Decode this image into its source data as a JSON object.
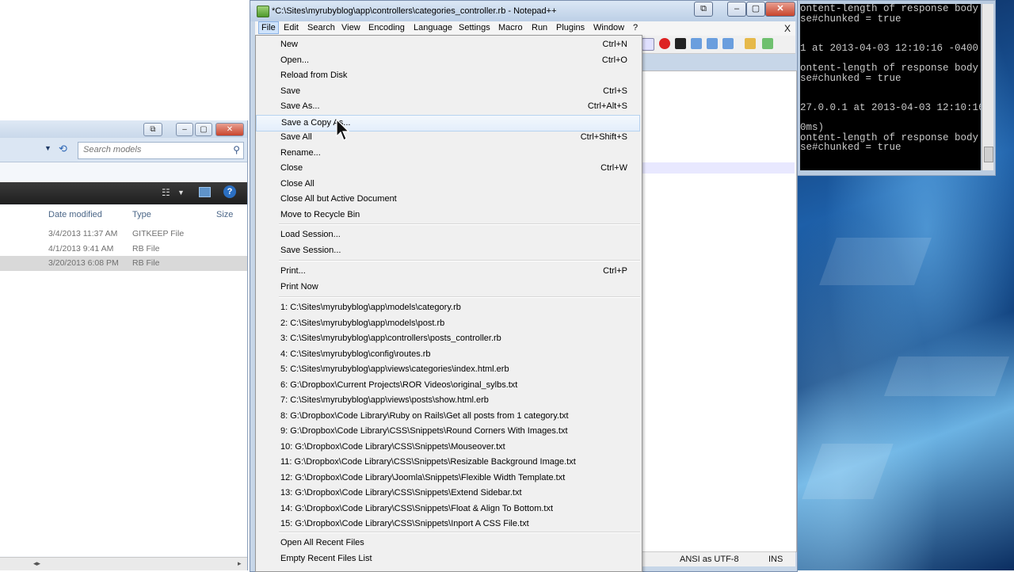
{
  "console": {
    "lines": [
      "ontent-length of response body.",
      "se#chunked = true",
      "",
      "",
      "1 at 2013-04-03 12:10:16 -0400",
      "",
      "ontent-length of response body.",
      "se#chunked = true",
      "",
      "",
      "27.0.0.1 at 2013-04-03 12:10:16",
      "",
      "0ms)",
      "ontent-length of response body.",
      "se#chunked = true"
    ]
  },
  "explorer": {
    "search_placeholder": "Search models",
    "columns": [
      "Date modified",
      "Type",
      "Size"
    ],
    "rows": [
      {
        "date": "3/4/2013 11:37 AM",
        "type": "GITKEEP File"
      },
      {
        "date": "4/1/2013 9:41 AM",
        "type": "RB File"
      },
      {
        "date": "3/20/2013 6:08 PM",
        "type": "RB File"
      }
    ]
  },
  "notepad": {
    "title": "*C:\\Sites\\myrubyblog\\app\\controllers\\categories_controller.rb - Notepad++",
    "menus": [
      "File",
      "Edit",
      "Search",
      "View",
      "Encoding",
      "Language",
      "Settings",
      "Macro",
      "Run",
      "Plugins",
      "Window",
      "?"
    ],
    "close_doc": "X",
    "status": {
      "encoding": "ANSI as UTF-8",
      "mode": "INS"
    }
  },
  "file_menu": {
    "items": [
      {
        "label": "New",
        "shortcut": "Ctrl+N"
      },
      {
        "label": "Open...",
        "shortcut": "Ctrl+O"
      },
      {
        "label": "Reload from Disk",
        "shortcut": ""
      },
      {
        "label": "Save",
        "shortcut": "Ctrl+S"
      },
      {
        "label": "Save As...",
        "shortcut": "Ctrl+Alt+S"
      },
      {
        "label": "Save a Copy As...",
        "shortcut": ""
      },
      {
        "label": "Save All",
        "shortcut": "Ctrl+Shift+S"
      },
      {
        "label": "Rename...",
        "shortcut": ""
      },
      {
        "label": "Close",
        "shortcut": "Ctrl+W"
      },
      {
        "label": "Close All",
        "shortcut": ""
      },
      {
        "label": "Close All but Active Document",
        "shortcut": ""
      },
      {
        "label": "Move to Recycle Bin",
        "shortcut": ""
      },
      {
        "label": "Load Session...",
        "shortcut": ""
      },
      {
        "label": "Save Session...",
        "shortcut": ""
      },
      {
        "label": "Print...",
        "shortcut": "Ctrl+P"
      },
      {
        "label": "Print Now",
        "shortcut": ""
      },
      {
        "label": "1: C:\\Sites\\myrubyblog\\app\\models\\category.rb",
        "shortcut": ""
      },
      {
        "label": "2: C:\\Sites\\myrubyblog\\app\\models\\post.rb",
        "shortcut": ""
      },
      {
        "label": "3: C:\\Sites\\myrubyblog\\app\\controllers\\posts_controller.rb",
        "shortcut": ""
      },
      {
        "label": "4: C:\\Sites\\myrubyblog\\config\\routes.rb",
        "shortcut": ""
      },
      {
        "label": "5: C:\\Sites\\myrubyblog\\app\\views\\categories\\index.html.erb",
        "shortcut": ""
      },
      {
        "label": "6: G:\\Dropbox\\Current Projects\\ROR Videos\\original_sylbs.txt",
        "shortcut": ""
      },
      {
        "label": "7: C:\\Sites\\myrubyblog\\app\\views\\posts\\show.html.erb",
        "shortcut": ""
      },
      {
        "label": "8: G:\\Dropbox\\Code Library\\Ruby on Rails\\Get all posts from 1 category.txt",
        "shortcut": ""
      },
      {
        "label": "9: G:\\Dropbox\\Code Library\\CSS\\Snippets\\Round Corners With Images.txt",
        "shortcut": ""
      },
      {
        "label": "10: G:\\Dropbox\\Code Library\\CSS\\Snippets\\Mouseover.txt",
        "shortcut": ""
      },
      {
        "label": "11: G:\\Dropbox\\Code Library\\CSS\\Snippets\\Resizable Background Image.txt",
        "shortcut": ""
      },
      {
        "label": "12: G:\\Dropbox\\Code Library\\Joomla\\Snippets\\Flexible Width Template.txt",
        "shortcut": ""
      },
      {
        "label": "13: G:\\Dropbox\\Code Library\\CSS\\Snippets\\Extend Sidebar.txt",
        "shortcut": ""
      },
      {
        "label": "14: G:\\Dropbox\\Code Library\\CSS\\Snippets\\Float & Align To Bottom.txt",
        "shortcut": ""
      },
      {
        "label": "15: G:\\Dropbox\\Code Library\\CSS\\Snippets\\Inport A CSS File.txt",
        "shortcut": ""
      },
      {
        "label": "Open All Recent Files",
        "shortcut": ""
      },
      {
        "label": "Empty Recent Files List",
        "shortcut": ""
      }
    ],
    "hovered_item": "Save a Copy As..."
  }
}
